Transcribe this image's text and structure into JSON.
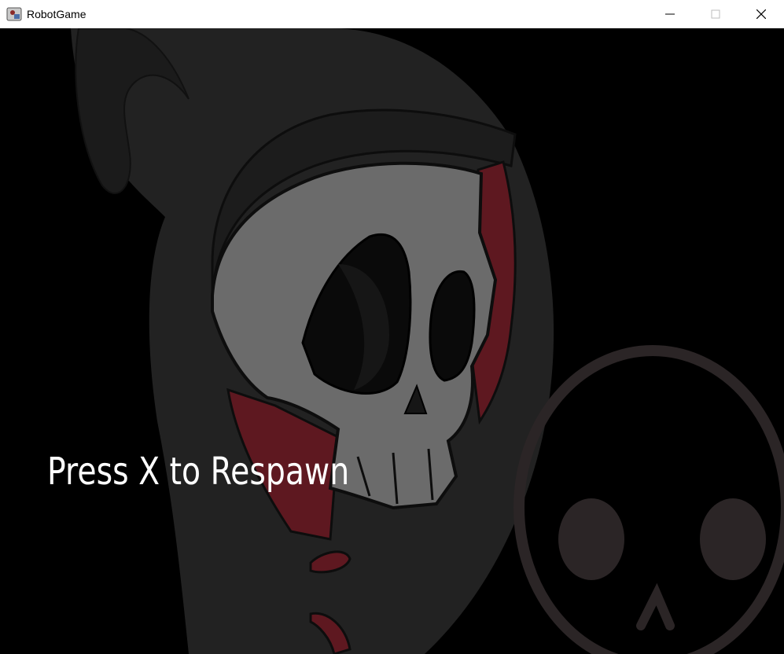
{
  "window": {
    "title": "RobotGame",
    "controls": {
      "minimize_icon": "minimize-icon",
      "maximize_icon": "maximize-icon",
      "close_icon": "close-icon"
    }
  },
  "game": {
    "message": "Press X to Respawn",
    "colors": {
      "background": "#000000",
      "hood": "#222222",
      "skull": "#6b6b6b",
      "accent_red": "#5e1820",
      "text": "#ffffff"
    }
  }
}
